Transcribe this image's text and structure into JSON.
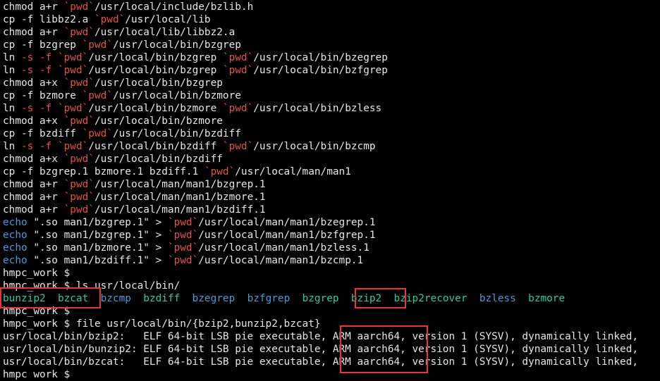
{
  "terminal": {
    "lines": [
      [
        [
          "w",
          "chmod a+r "
        ],
        [
          "r",
          "`pwd`"
        ],
        [
          "w",
          "/usr/local/include/bzlib.h"
        ]
      ],
      [
        [
          "w",
          "cp -f libbz2.a "
        ],
        [
          "r",
          "`pwd`"
        ],
        [
          "w",
          "/usr/local/lib"
        ]
      ],
      [
        [
          "w",
          "chmod a+r "
        ],
        [
          "r",
          "`pwd`"
        ],
        [
          "w",
          "/usr/local/lib/libbz2.a"
        ]
      ],
      [
        [
          "w",
          "cp -f bzgrep "
        ],
        [
          "r",
          "`pwd`"
        ],
        [
          "w",
          "/usr/local/bin/bzgrep"
        ]
      ],
      [
        [
          "w",
          "ln "
        ],
        [
          "r",
          "-s -f "
        ],
        [
          "r",
          "`pwd`"
        ],
        [
          "w",
          "/usr/local/bin/bzgrep "
        ],
        [
          "r",
          "`pwd`"
        ],
        [
          "w",
          "/usr/local/bin/bzegrep"
        ]
      ],
      [
        [
          "w",
          "ln "
        ],
        [
          "r",
          "-s -f "
        ],
        [
          "r",
          "`pwd`"
        ],
        [
          "w",
          "/usr/local/bin/bzgrep "
        ],
        [
          "r",
          "`pwd`"
        ],
        [
          "w",
          "/usr/local/bin/bzfgrep"
        ]
      ],
      [
        [
          "w",
          "chmod a+x "
        ],
        [
          "r",
          "`pwd`"
        ],
        [
          "w",
          "/usr/local/bin/bzgrep"
        ]
      ],
      [
        [
          "w",
          "cp -f bzmore "
        ],
        [
          "r",
          "`pwd`"
        ],
        [
          "w",
          "/usr/local/bin/bzmore"
        ]
      ],
      [
        [
          "w",
          "ln "
        ],
        [
          "r",
          "-s -f "
        ],
        [
          "r",
          "`pwd`"
        ],
        [
          "w",
          "/usr/local/bin/bzmore "
        ],
        [
          "r",
          "`pwd`"
        ],
        [
          "w",
          "/usr/local/bin/bzless"
        ]
      ],
      [
        [
          "w",
          "chmod a+x "
        ],
        [
          "r",
          "`pwd`"
        ],
        [
          "w",
          "/usr/local/bin/bzmore"
        ]
      ],
      [
        [
          "w",
          "cp -f bzdiff "
        ],
        [
          "r",
          "`pwd`"
        ],
        [
          "w",
          "/usr/local/bin/bzdiff"
        ]
      ],
      [
        [
          "w",
          "ln "
        ],
        [
          "r",
          "-s -f "
        ],
        [
          "r",
          "`pwd`"
        ],
        [
          "w",
          "/usr/local/bin/bzdiff "
        ],
        [
          "r",
          "`pwd`"
        ],
        [
          "w",
          "/usr/local/bin/bzcmp"
        ]
      ],
      [
        [
          "w",
          "chmod a+x "
        ],
        [
          "r",
          "`pwd`"
        ],
        [
          "w",
          "/usr/local/bin/bzdiff"
        ]
      ],
      [
        [
          "w",
          "cp -f bzgrep.1 bzmore.1 bzdiff.1 "
        ],
        [
          "r",
          "`pwd`"
        ],
        [
          "w",
          "/usr/local/man/man1"
        ]
      ],
      [
        [
          "w",
          "chmod a+r "
        ],
        [
          "r",
          "`pwd`"
        ],
        [
          "w",
          "/usr/local/man/man1/bzgrep.1"
        ]
      ],
      [
        [
          "w",
          "chmod a+r "
        ],
        [
          "r",
          "`pwd`"
        ],
        [
          "w",
          "/usr/local/man/man1/bzmore.1"
        ]
      ],
      [
        [
          "w",
          "chmod a+r "
        ],
        [
          "r",
          "`pwd`"
        ],
        [
          "w",
          "/usr/local/man/man1/bzdiff.1"
        ]
      ],
      [
        [
          "b",
          "echo"
        ],
        [
          "w",
          " \".so man1/bzgrep.1\" > "
        ],
        [
          "r",
          "`pwd`"
        ],
        [
          "w",
          "/usr/local/man/man1/bzegrep.1"
        ]
      ],
      [
        [
          "b",
          "echo"
        ],
        [
          "w",
          " \".so man1/bzgrep.1\" > "
        ],
        [
          "r",
          "`pwd`"
        ],
        [
          "w",
          "/usr/local/man/man1/bzfgrep.1"
        ]
      ],
      [
        [
          "b",
          "echo"
        ],
        [
          "w",
          " \".so man1/bzmore.1\" > "
        ],
        [
          "r",
          "`pwd`"
        ],
        [
          "w",
          "/usr/local/man/man1/bzless.1"
        ]
      ],
      [
        [
          "b",
          "echo"
        ],
        [
          "w",
          " \".so man1/bzdiff.1\" > "
        ],
        [
          "r",
          "`pwd`"
        ],
        [
          "w",
          "/usr/local/man/man1/bzcmp.1"
        ]
      ],
      [
        [
          "w",
          "hmpc_work $"
        ]
      ],
      [
        [
          "w",
          "hmpc_work $ ls usr/local/bin/"
        ]
      ],
      [
        [
          "g",
          "bunzip2"
        ],
        [
          "w",
          "  "
        ],
        [
          "g",
          "bzcat"
        ],
        [
          "w",
          "  "
        ],
        [
          "b",
          "bzcmp"
        ],
        [
          "w",
          "  "
        ],
        [
          "g",
          "bzdiff"
        ],
        [
          "w",
          "  "
        ],
        [
          "b",
          "bzegrep"
        ],
        [
          "w",
          "  "
        ],
        [
          "b",
          "bzfgrep"
        ],
        [
          "w",
          "  "
        ],
        [
          "g",
          "bzgrep"
        ],
        [
          "w",
          "  "
        ],
        [
          "g",
          "bzip2"
        ],
        [
          "w",
          "  "
        ],
        [
          "g",
          "bzip2recover"
        ],
        [
          "w",
          "  "
        ],
        [
          "b",
          "bzless"
        ],
        [
          "w",
          "  "
        ],
        [
          "g",
          "bzmore"
        ]
      ],
      [
        [
          "w",
          "hmpc_work $"
        ]
      ],
      [
        [
          "w",
          "hmpc_work $ file usr/local/bin/{bzip2,bunzip2,bzcat}"
        ]
      ],
      [
        [
          "w",
          "usr/local/bin/bzip2:   ELF 64-bit LSB pie executable, ARM aarch64, version 1 (SYSV), dynamically linked,"
        ]
      ],
      [
        [
          "w",
          "usr/local/bin/bunzip2: ELF 64-bit LSB pie executable, ARM aarch64, version 1 (SYSV), dynamically linked,"
        ]
      ],
      [
        [
          "w",
          "usr/local/bin/bzcat:   ELF 64-bit LSB pie executable, ARM aarch64, version 1 (SYSV), dynamically linked,"
        ]
      ],
      [
        [
          "w",
          "hmpc work $"
        ]
      ]
    ]
  },
  "colors": {
    "background": "#000000",
    "text": "#e6e6e6",
    "pwd": "#e0524a",
    "builtin": "#4a9ad8",
    "executable": "#2fc9a4",
    "highlight_box": "#e8343a"
  }
}
